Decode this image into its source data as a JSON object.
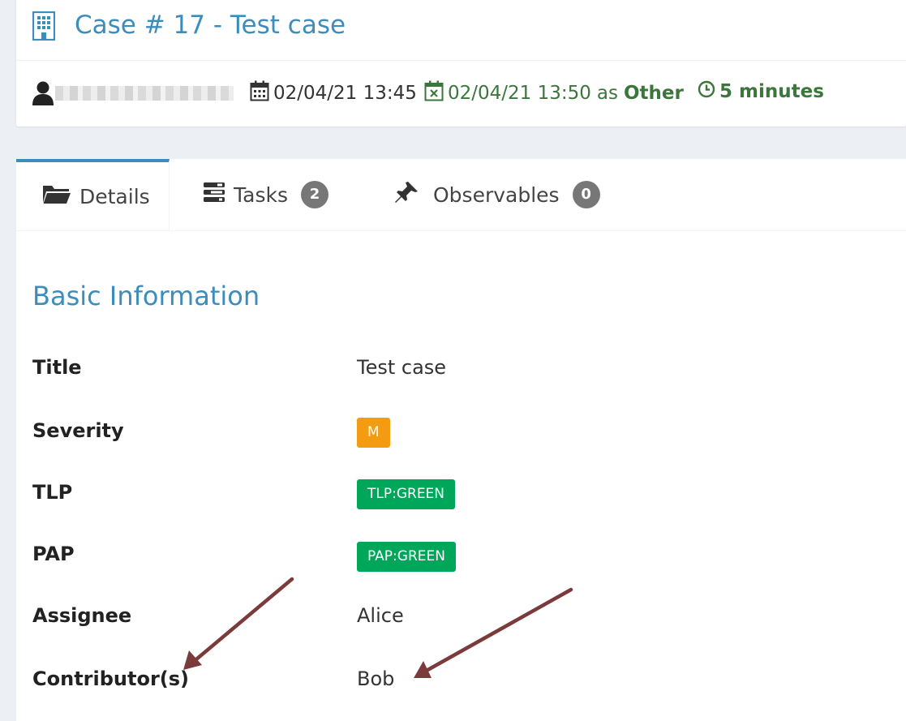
{
  "header": {
    "case_title": "Case # 17 - Test case",
    "start_date": "02/04/21 13:45",
    "end_date": "02/04/21 13:50",
    "as_text": "as",
    "resolution": "Other",
    "duration": "5 minutes"
  },
  "tabs": [
    {
      "label": "Details",
      "icon": "folder-open-icon"
    },
    {
      "label": "Tasks",
      "icon": "tasks-icon",
      "count": "2"
    },
    {
      "label": "Observables",
      "icon": "pushpin-icon",
      "count": "0"
    }
  ],
  "basic_info": {
    "title": "Basic Information",
    "fields": {
      "title": {
        "label": "Title",
        "value": "Test case"
      },
      "severity": {
        "label": "Severity",
        "value": "M"
      },
      "tlp": {
        "label": "TLP",
        "value": "TLP:GREEN"
      },
      "pap": {
        "label": "PAP",
        "value": "PAP:GREEN"
      },
      "assignee": {
        "label": "Assignee",
        "value": "Alice"
      },
      "contributors": {
        "label": "Contributor(s)",
        "value": "Bob"
      }
    }
  },
  "colors": {
    "primary": "#3c8dbc",
    "success_text": "#3c763d",
    "severity_medium": "#f39c12",
    "tlp_green": "#00a65a",
    "annotation_arrow": "#7b3b3b"
  }
}
